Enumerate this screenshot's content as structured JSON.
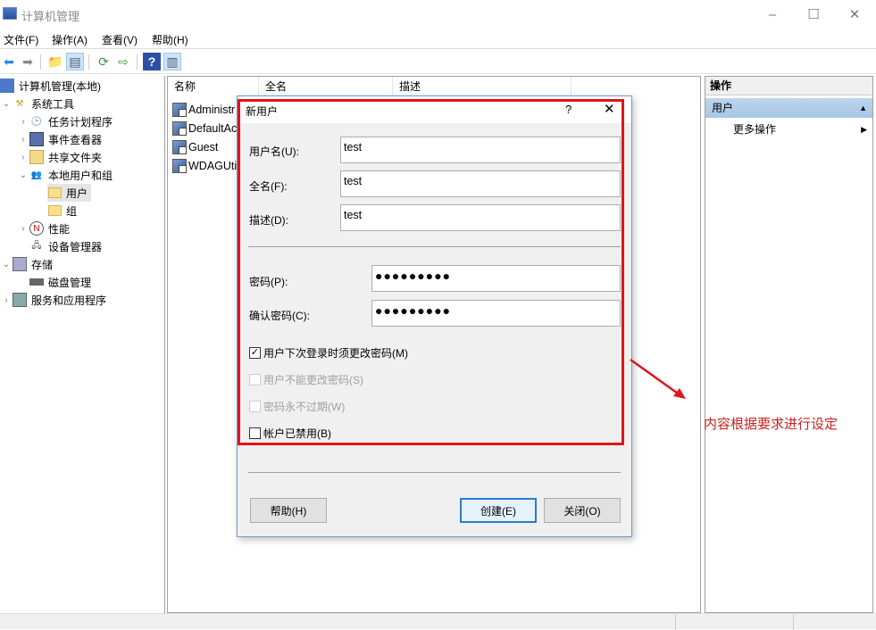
{
  "window": {
    "title": "计算机管理",
    "controls": {
      "minimize": "–",
      "maximize": "☐",
      "close": "✕"
    }
  },
  "menu": [
    "文件(F)",
    "操作(A)",
    "查看(V)",
    "帮助(H)"
  ],
  "toolbar": [
    {
      "icon": "back-icon",
      "glyph": "⬅"
    },
    {
      "icon": "forward-icon",
      "glyph": "➡"
    },
    {
      "icon": "up-folder-icon",
      "glyph": "📁"
    },
    {
      "icon": "show-hide-tree-icon",
      "glyph": "▤"
    },
    {
      "icon": "refresh-icon",
      "glyph": "⟳"
    },
    {
      "icon": "export-list-icon",
      "glyph": "⇨"
    },
    {
      "icon": "help-icon",
      "glyph": "?"
    },
    {
      "icon": "show-hide-action-pane-icon",
      "glyph": "▥"
    }
  ],
  "tree": [
    {
      "label": "计算机管理(本地)",
      "level": 0,
      "twisty": "",
      "icon": "computer-icon"
    },
    {
      "label": "系统工具",
      "level": 0,
      "twisty": "⌄",
      "icon": "tools-icon"
    },
    {
      "label": "任务计划程序",
      "level": 1,
      "twisty": "›",
      "icon": "clock-icon"
    },
    {
      "label": "事件查看器",
      "level": 1,
      "twisty": "›",
      "icon": "event-viewer-icon"
    },
    {
      "label": "共享文件夹",
      "level": 1,
      "twisty": "›",
      "icon": "shared-folder-icon"
    },
    {
      "label": "本地用户和组",
      "level": 1,
      "twisty": "⌄",
      "icon": "users-group-icon"
    },
    {
      "label": "用户",
      "level": 2,
      "twisty": "",
      "icon": "folder-icon",
      "selected": true
    },
    {
      "label": "组",
      "level": 2,
      "twisty": "",
      "icon": "folder-icon"
    },
    {
      "label": "性能",
      "level": 1,
      "twisty": "›",
      "icon": "performance-icon"
    },
    {
      "label": "设备管理器",
      "level": 1,
      "twisty": "",
      "icon": "device-manager-icon"
    },
    {
      "label": "存储",
      "level": 0,
      "twisty": "⌄",
      "icon": "storage-icon"
    },
    {
      "label": "磁盘管理",
      "level": 1,
      "twisty": "",
      "icon": "disk-icon"
    },
    {
      "label": "服务和应用程序",
      "level": 0,
      "twisty": "›",
      "icon": "services-icon"
    }
  ],
  "list": {
    "columns": [
      "名称",
      "全名",
      "描述"
    ],
    "rows": [
      "Administr",
      "DefaultAc",
      "Guest",
      "WDAGUti"
    ]
  },
  "actions": {
    "header": "操作",
    "section": "用户",
    "more": "更多操作",
    "collapse_glyph": "▲",
    "more_glyph": "▶"
  },
  "dialog": {
    "title": "新用户",
    "help": "?",
    "close": "✕",
    "username": {
      "label": "用户名(U):",
      "value": "test"
    },
    "fullname": {
      "label": "全名(F):",
      "value": "test"
    },
    "description": {
      "label": "描述(D):",
      "value": "test"
    },
    "password": {
      "label": "密码(P):",
      "value": "●●●●●●●●●"
    },
    "confirm": {
      "label": "确认密码(C):",
      "value": "●●●●●●●●●"
    },
    "checkboxes": [
      {
        "label": "用户下次登录时须更改密码(M)",
        "checked": true,
        "disabled": false
      },
      {
        "label": "用户不能更改密码(S)",
        "checked": false,
        "disabled": true
      },
      {
        "label": "密码永不过期(W)",
        "checked": false,
        "disabled": true
      },
      {
        "label": "帐户已禁用(B)",
        "checked": false,
        "disabled": false
      }
    ],
    "buttons": {
      "help": "帮助(H)",
      "create": "创建(E)",
      "close": "关闭(O)"
    }
  },
  "annotation": {
    "text": "内容根据要求进行设定",
    "color": "#cc2222",
    "highlight_color": "#e0141b"
  }
}
